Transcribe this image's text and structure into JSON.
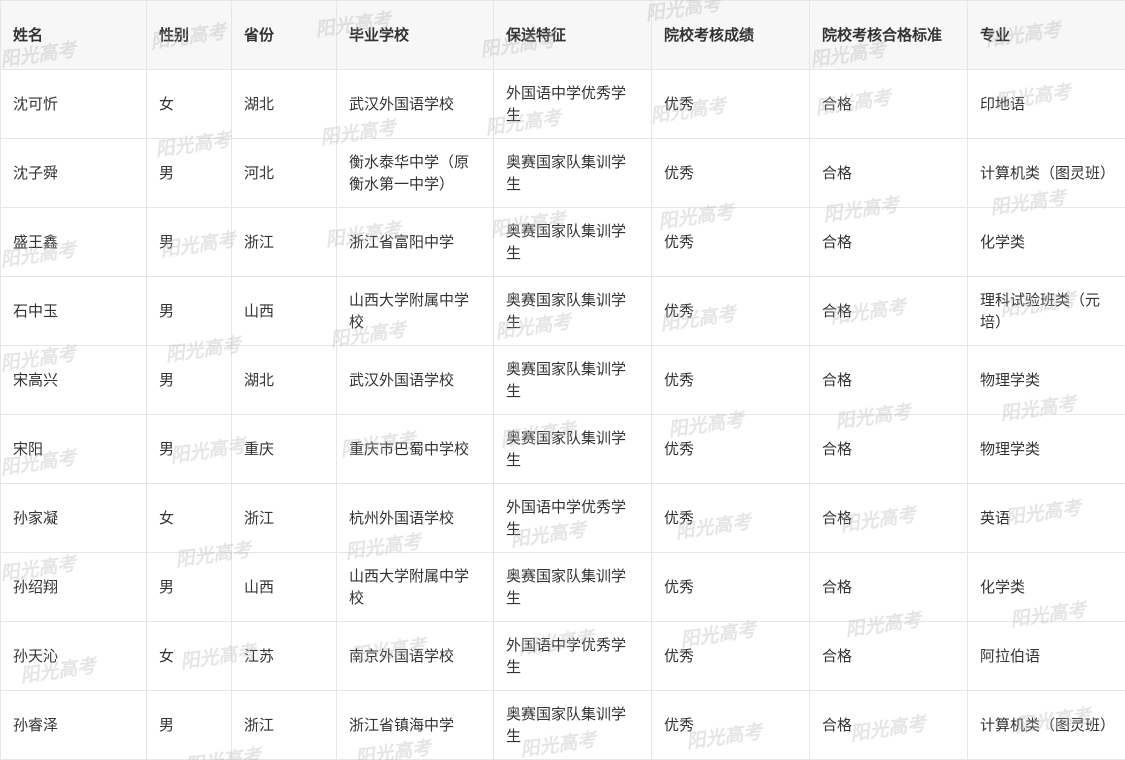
{
  "table": {
    "headers": [
      "姓名",
      "性别",
      "省份",
      "毕业学校",
      "保送特征",
      "院校考核成绩",
      "院校考核合格标准",
      "专业"
    ],
    "rows": [
      [
        "沈可忻",
        "女",
        "湖北",
        "武汉外国语学校",
        "外国语中学优秀学生",
        "优秀",
        "合格",
        "印地语"
      ],
      [
        "沈子舜",
        "男",
        "河北",
        "衡水泰华中学（原衡水第一中学）",
        "奥赛国家队集训学生",
        "优秀",
        "合格",
        "计算机类（图灵班）"
      ],
      [
        "盛王鑫",
        "男",
        "浙江",
        "浙江省富阳中学",
        "奥赛国家队集训学生",
        "优秀",
        "合格",
        "化学类"
      ],
      [
        "石中玉",
        "男",
        "山西",
        "山西大学附属中学校",
        "奥赛国家队集训学生",
        "优秀",
        "合格",
        "理科试验班类（元培）"
      ],
      [
        "宋高兴",
        "男",
        "湖北",
        "武汉外国语学校",
        "奥赛国家队集训学生",
        "优秀",
        "合格",
        "物理学类"
      ],
      [
        "宋阳",
        "男",
        "重庆",
        "重庆市巴蜀中学校",
        "奥赛国家队集训学生",
        "优秀",
        "合格",
        "物理学类"
      ],
      [
        "孙家凝",
        "女",
        "浙江",
        "杭州外国语学校",
        "外国语中学优秀学生",
        "优秀",
        "合格",
        "英语"
      ],
      [
        "孙绍翔",
        "男",
        "山西",
        "山西大学附属中学校",
        "奥赛国家队集训学生",
        "优秀",
        "合格",
        "化学类"
      ],
      [
        "孙天沁",
        "女",
        "江苏",
        "南京外国语学校",
        "外国语中学优秀学生",
        "优秀",
        "合格",
        "阿拉伯语"
      ],
      [
        "孙睿泽",
        "男",
        "浙江",
        "浙江省镇海中学",
        "奥赛国家队集训学生",
        "优秀",
        "合格",
        "计算机类（图灵班）"
      ]
    ]
  },
  "watermark": {
    "text": "阳光高考"
  }
}
